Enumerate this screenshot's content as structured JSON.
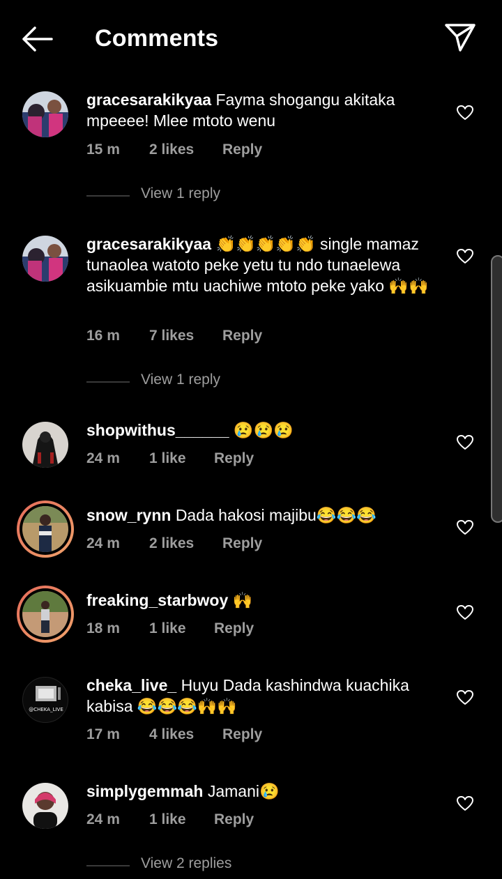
{
  "header": {
    "title": "Comments",
    "back_icon": "arrow-left-icon",
    "send_icon": "paper-plane-icon"
  },
  "comments": [
    {
      "username": "gracesarakikyaa",
      "text": "Fayma shogangu akitaka mpeeee! Mlee mtoto wenu",
      "time": "15 m",
      "likes": "2 likes",
      "reply": "Reply",
      "view_replies": "View 1 reply",
      "avatar_ring": false
    },
    {
      "username": "gracesarakikyaa",
      "text": "👏👏👏👏👏 single mamaz tunaolea watoto peke yetu tu ndo tunaelewa asikuambie mtu uachiwe mtoto peke yako 🙌🙌",
      "time": "16 m",
      "likes": "7 likes",
      "reply": "Reply",
      "view_replies": "View 1 reply",
      "avatar_ring": false
    },
    {
      "username": "shopwithus______",
      "text": "😢😢😢",
      "time": "24 m",
      "likes": "1 like",
      "reply": "Reply",
      "avatar_ring": false
    },
    {
      "username": "snow_rynn",
      "text": "Dada hakosi majibu😂😂😂",
      "time": "24 m",
      "likes": "2 likes",
      "reply": "Reply",
      "avatar_ring": true
    },
    {
      "username": "freaking_starbwoy",
      "text": "🙌",
      "time": "18 m",
      "likes": "1 like",
      "reply": "Reply",
      "avatar_ring": true
    },
    {
      "username": "cheka_live_",
      "text": "Huyu Dada kashindwa kuachika kabisa 😂😂😂🙌🙌",
      "time": "17 m",
      "likes": "4 likes",
      "reply": "Reply",
      "avatar_ring": false,
      "avatar_text": "@CHEKA_LIVE"
    },
    {
      "username": "simplygemmah",
      "text": "Jamani😢",
      "time": "24 m",
      "likes": "1 like",
      "reply": "Reply",
      "view_replies": "View 2 replies",
      "avatar_ring": false
    }
  ],
  "colors": {
    "background": "#000000",
    "text": "#ffffff",
    "meta": "#9e9e9e",
    "story_ring": "#e8855f"
  }
}
